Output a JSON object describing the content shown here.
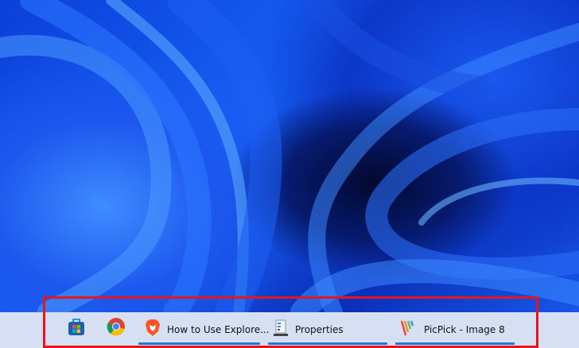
{
  "taskbar": {
    "pinned": [
      {
        "name": "microsoft-store-icon"
      },
      {
        "name": "chrome-icon"
      }
    ],
    "apps": [
      {
        "label": "How to Use Explore...",
        "icon": "brave-icon"
      },
      {
        "label": "Properties",
        "icon": "properties-icon"
      },
      {
        "label": "PicPick - Image 8",
        "icon": "picpick-icon"
      }
    ]
  },
  "colors": {
    "highlight": "#e8141c",
    "active_underline": "#1d78d6",
    "taskbar_bg": "#d7e0f2"
  }
}
